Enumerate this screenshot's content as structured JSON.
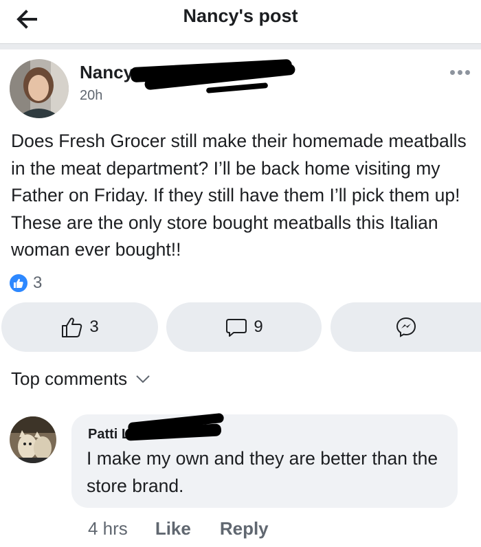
{
  "header": {
    "title": "Nancy's post",
    "back_icon": "arrow-left-icon"
  },
  "post": {
    "author": "Nancy",
    "time": "20h",
    "text": "Does Fresh Grocer still make their homemade meatballs in the meat department?  I’ll be back home visiting my Father on Friday. If they still have them I’ll pick them up! These are the only store bought meatballs this Italian woman ever bought!!",
    "reaction_count": "3"
  },
  "actions": {
    "like_count": "3",
    "comment_count": "9"
  },
  "comments_sort_label": "Top comments",
  "comment": {
    "author": "Patti L",
    "text": "I make my own and they are better than the store brand.",
    "time": "4 hrs",
    "like_label": "Like",
    "reply_label": "Reply"
  },
  "colors": {
    "like_blue": "#2d88ff",
    "pill_bg": "#e9ecf0",
    "bubble_bg": "#f0f2f5",
    "muted": "#606770"
  }
}
